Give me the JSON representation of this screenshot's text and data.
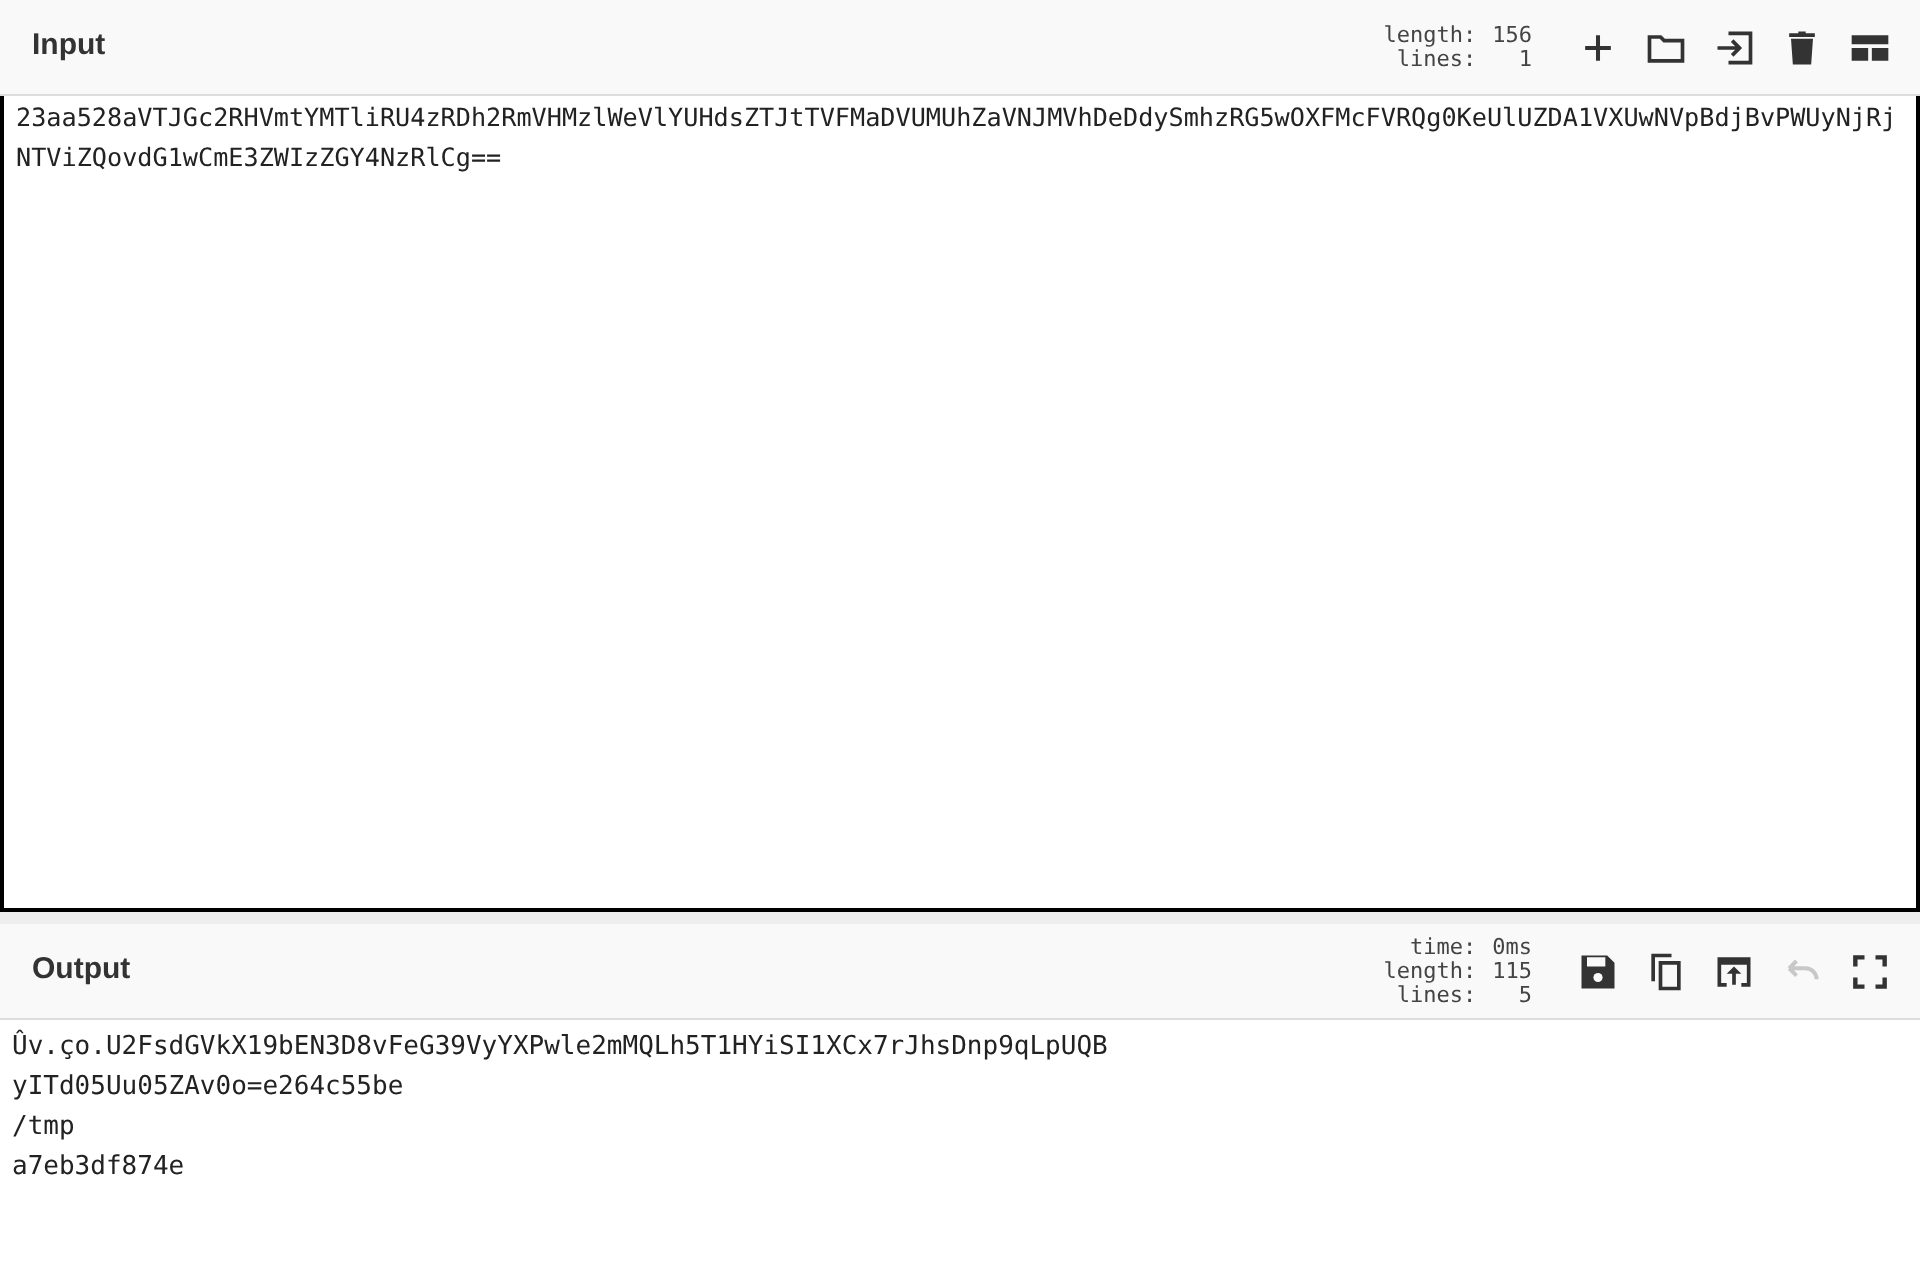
{
  "input": {
    "title": "Input",
    "stats": [
      {
        "label": "length:",
        "value": "156"
      },
      {
        "label": "lines:",
        "value": "1"
      }
    ],
    "buttons": [
      {
        "kind": "add"
      },
      {
        "kind": "open"
      },
      {
        "kind": "load"
      },
      {
        "kind": "delete"
      },
      {
        "kind": "layout"
      }
    ],
    "text": "23aa528aVTJGc2RHVmtYMTliRU4zRDh2RmVHMzlWeVlYUHdsZTJtTVFMaDVUMUhZaVNJMVhDeDdySmhzRG5wOXFMcFVRQg0KeUlUZDA1VXUwNVpBdjBvPWUyNjRjNTViZQovdG1wCmE3ZWIzZGY4NzRlCg=="
  },
  "output": {
    "title": "Output",
    "stats": [
      {
        "label": "time:",
        "value": "0ms"
      },
      {
        "label": "length:",
        "value": "115"
      },
      {
        "label": "lines:",
        "value": "5"
      }
    ],
    "buttons": [
      {
        "kind": "save",
        "disabled": false
      },
      {
        "kind": "copy",
        "disabled": false
      },
      {
        "kind": "replace",
        "disabled": false
      },
      {
        "kind": "undo",
        "disabled": true
      },
      {
        "kind": "maximise",
        "disabled": false
      }
    ],
    "lines": [
      "Ûv.ço.U2FsdGVkX19bEN3D8vFeG39VyYXPwle2mMQLh5T1HYiSI1XCx7rJhsDnp9qLpUQB",
      "yITd05Uu05ZAv0o=e264c55be",
      "/tmp",
      "a7eb3df874e"
    ]
  }
}
